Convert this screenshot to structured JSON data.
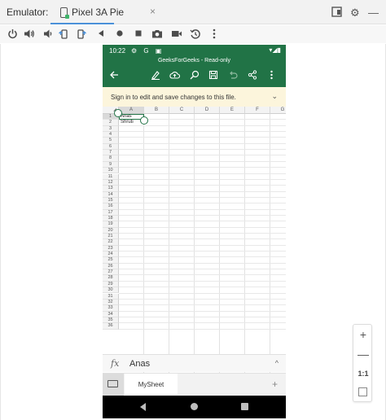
{
  "window": {
    "label": "Emulator:",
    "tab_name": "Pixel 3A Pie",
    "tab_close": "×",
    "right_icons": [
      "window-mode-icon",
      "gear-icon",
      "minimize-icon"
    ],
    "gear_glyph": "⚙",
    "minimize_glyph": "—"
  },
  "toolbar": {
    "icons": [
      "power-icon",
      "volume-up-icon",
      "volume-down-icon",
      "rotate-left-icon",
      "rotate-right-icon",
      "back-icon",
      "home-icon",
      "overview-icon",
      "screenshot-icon",
      "screen-record-icon",
      "snapshot-icon",
      "more-icon"
    ]
  },
  "phone": {
    "status": {
      "time": "10:22",
      "left_icons": "⚙ G ▣",
      "right_icons": "▾◢▮"
    },
    "appbar": {
      "title": "GeeksForGeeks - Read-only",
      "icons": [
        "back-arrow-icon",
        "draw-icon",
        "cloud-upload-icon",
        "search-icon",
        "save-icon",
        "undo-icon",
        "share-icon",
        "more-vert-icon"
      ]
    },
    "signin": {
      "text": "Sign in to edit and save changes to this file.",
      "chevron": "⌄"
    },
    "grid": {
      "columns": [
        "A",
        "B",
        "C",
        "D",
        "E",
        "F",
        "G"
      ],
      "rows": [
        "1",
        "2",
        "3",
        "4",
        "5",
        "6",
        "7",
        "8",
        "9",
        "10",
        "11",
        "12",
        "13",
        "14",
        "15",
        "16",
        "17",
        "18",
        "19",
        "20",
        "21",
        "22",
        "23",
        "24",
        "25",
        "26",
        "27",
        "28",
        "29",
        "30",
        "31",
        "32",
        "33",
        "34",
        "35",
        "36"
      ],
      "cells": {
        "A1": "Anas",
        "A2": "Shruti"
      },
      "selected_cell": "A1"
    },
    "formula": {
      "icon": "fx",
      "value": "Anas",
      "chevron": "^"
    },
    "sheets": {
      "active": "MySheet",
      "add": "+"
    }
  },
  "zoom": {
    "plus": "+",
    "minus": "—",
    "ratio": "1:1"
  },
  "colors": {
    "excel_green": "#217346",
    "banner": "#fcf5dc",
    "tab_underline": "#4a90d9"
  }
}
